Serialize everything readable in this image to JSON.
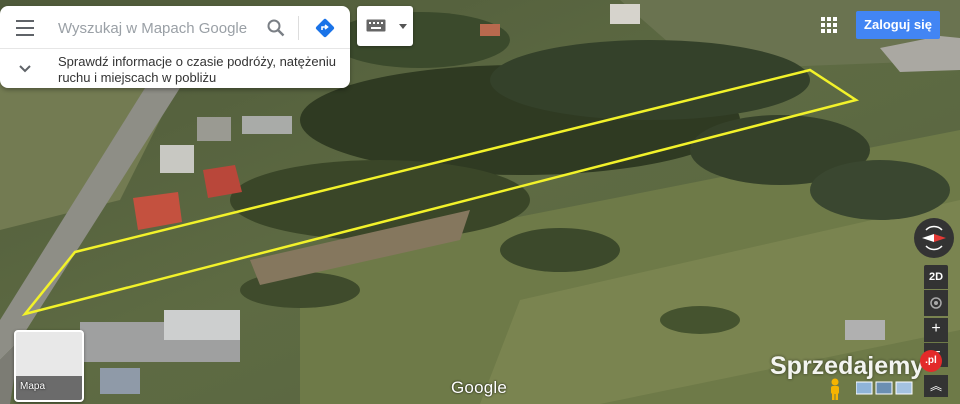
{
  "search": {
    "placeholder": "Wyszukaj w Mapach Google",
    "info_text": "Sprawdź informacje o czasie podróży, natężeniu ruchu i miejscach w pobliżu"
  },
  "header": {
    "login_label": "Zaloguj się"
  },
  "controls": {
    "mode_2d_label": "2D",
    "zoom_in_label": "+",
    "zoom_out_label": "−",
    "tilt_label": "︽"
  },
  "layers": {
    "map_thumbnail_label": "Mapa"
  },
  "footer": {
    "google_logo": "Google"
  },
  "watermark": {
    "text": "Sprzedajemy",
    "badge": ".pl"
  },
  "colors": {
    "parcel_outline": "#f2f22a",
    "login_button": "#4285f4",
    "directions_icon": "#1a73e8"
  },
  "icons": [
    "menu-icon",
    "search-icon",
    "directions-icon",
    "chevron-down-icon",
    "keyboard-icon",
    "apps-grid-icon",
    "compass-icon",
    "location-icon",
    "pegman-icon"
  ]
}
